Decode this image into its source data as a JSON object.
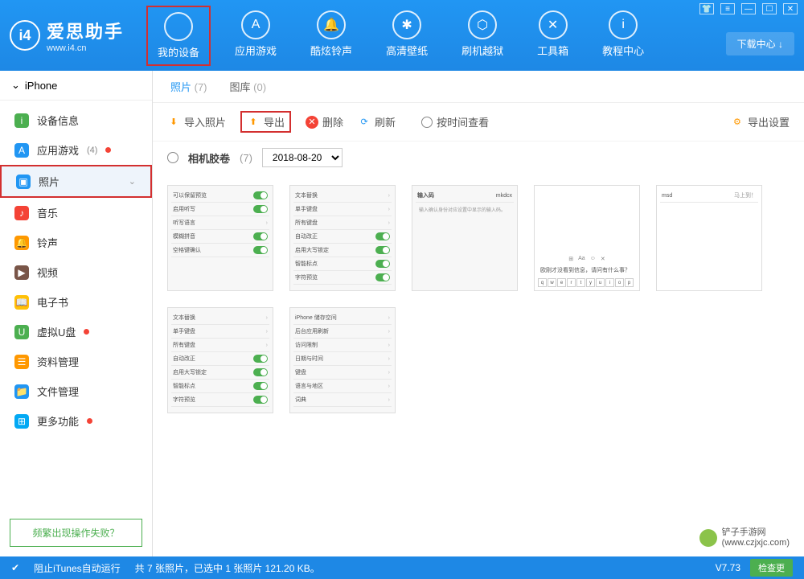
{
  "header": {
    "logo_text": "爱思助手",
    "logo_sub": "www.i4.cn",
    "logo_badge": "i4",
    "download_center": "下载中心 ↓",
    "nav": [
      {
        "label": "我的设备",
        "icon": ""
      },
      {
        "label": "应用游戏",
        "icon": "A"
      },
      {
        "label": "酷炫铃声",
        "icon": "🔔"
      },
      {
        "label": "高清壁纸",
        "icon": "✱"
      },
      {
        "label": "刷机越狱",
        "icon": "⬡"
      },
      {
        "label": "工具箱",
        "icon": "✕"
      },
      {
        "label": "教程中心",
        "icon": "i"
      }
    ]
  },
  "sidebar": {
    "device": "iPhone",
    "items": [
      {
        "label": "设备信息",
        "color": "#4CAF50",
        "glyph": "i"
      },
      {
        "label": "应用游戏",
        "color": "#2196F3",
        "glyph": "A",
        "count": "(4)",
        "dot": true
      },
      {
        "label": "照片",
        "color": "#2196F3",
        "glyph": "▣",
        "active": true,
        "highlighted": true,
        "chev": "⌄"
      },
      {
        "label": "音乐",
        "color": "#F44336",
        "glyph": "♪"
      },
      {
        "label": "铃声",
        "color": "#FF9800",
        "glyph": "🔔"
      },
      {
        "label": "视频",
        "color": "#795548",
        "glyph": "▶"
      },
      {
        "label": "电子书",
        "color": "#FFC107",
        "glyph": "📖"
      },
      {
        "label": "虚拟U盘",
        "color": "#4CAF50",
        "glyph": "U",
        "dot": true
      },
      {
        "label": "资料管理",
        "color": "#FF9800",
        "glyph": "☰"
      },
      {
        "label": "文件管理",
        "color": "#2196F3",
        "glyph": "📁"
      },
      {
        "label": "更多功能",
        "color": "#03A9F4",
        "glyph": "⊞",
        "dot": true
      }
    ],
    "fail_btn": "频繁出现操作失败？"
  },
  "main": {
    "tabs": [
      {
        "label": "照片",
        "count": "(7)",
        "active": true
      },
      {
        "label": "图库",
        "count": "(0)"
      }
    ],
    "toolbar": {
      "import": "导入照片",
      "export": "导出",
      "delete": "删除",
      "refresh": "刷新",
      "by_time": "按时间查看",
      "export_settings": "导出设置"
    },
    "filter": {
      "album": "相机胶卷",
      "count": "(7)",
      "date": "2018-08-20"
    },
    "thumbs": {
      "t1": [
        "可以保留预览",
        "启用听写",
        "听写语言",
        "模糊拼音",
        "空格键确认"
      ],
      "t2": [
        "文本替换",
        "单手键盘",
        "所有键盘",
        "自动改正",
        "启用大写锁定",
        "智能标点",
        "字符预览"
      ],
      "t3_title": "输入码",
      "t3_val": "mkdcx",
      "t3_sub": "输入确认身份对应设置中显示的输入码。",
      "t4_line": "欧刚才没看到信息，请问有什么事？",
      "t4_keys": [
        "q",
        "w",
        "e",
        "r",
        "t",
        "y",
        "u",
        "i",
        "o",
        "p"
      ],
      "t5_a": "msd",
      "t5_b": "马上到！",
      "t6": [
        "文本替换",
        "单手键盘",
        "所有键盘",
        "自动改正",
        "启用大写锁定",
        "智能标点",
        "字符预览"
      ],
      "t7": [
        "iPhone 储存空间",
        "后台应用刷新",
        "访问限制",
        "日期与时间",
        "键盘",
        "语言与地区",
        "词典"
      ]
    }
  },
  "status": {
    "itunes": "阻止iTunes自动运行",
    "info": "共 7 张照片，已选中 1 张照片 121.20 KB。",
    "version": "V7.73",
    "check": "检查更"
  },
  "watermark": "铲子手游网\n(www.czjxjc.com)"
}
